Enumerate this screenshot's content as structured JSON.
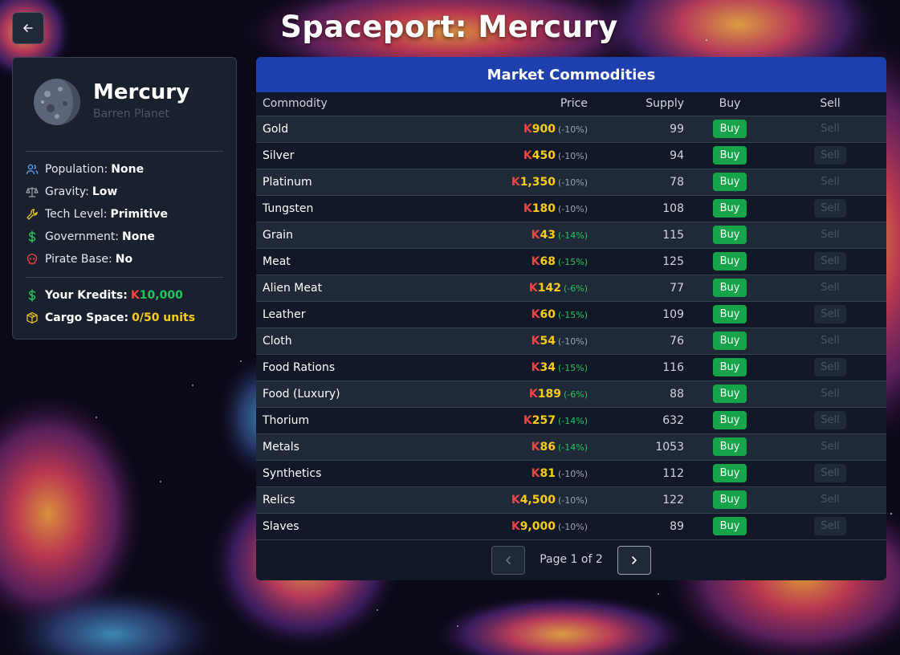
{
  "header": {
    "title": "Spaceport: Mercury",
    "back_icon": "arrow-left-icon"
  },
  "planet": {
    "name": "Mercury",
    "type": "Barren Planet",
    "icon": "planet-icon",
    "stats": [
      {
        "label": "Population:",
        "value": "None",
        "icon": "users-icon",
        "color": "#60a5fa"
      },
      {
        "label": "Gravity:",
        "value": "Low",
        "icon": "scale-icon",
        "color": "#9ca3af"
      },
      {
        "label": "Tech Level:",
        "value": "Primitive",
        "icon": "wrench-icon",
        "color": "#facc15"
      },
      {
        "label": "Government:",
        "value": "None",
        "icon": "dollar-icon",
        "color": "#22c55e"
      },
      {
        "label": "Pirate Base:",
        "value": "No",
        "icon": "skull-icon",
        "color": "#ef4444"
      }
    ],
    "credits": {
      "label": "Your Kredits:",
      "prefix": "K",
      "value": "10,000",
      "icon": "dollar-icon"
    },
    "cargo": {
      "label": "Cargo Space:",
      "value": "0/50 units",
      "icon": "box-icon"
    }
  },
  "market": {
    "title": "Market Commodities",
    "columns": [
      "Commodity",
      "Price",
      "Supply",
      "Buy",
      "Sell"
    ],
    "buy_label": "Buy",
    "sell_label": "Sell",
    "rows": [
      {
        "name": "Gold",
        "price": "900",
        "mod": "(-10%)",
        "mod_color": "gray",
        "supply": "99"
      },
      {
        "name": "Silver",
        "price": "450",
        "mod": "(-10%)",
        "mod_color": "gray",
        "supply": "94"
      },
      {
        "name": "Platinum",
        "price": "1,350",
        "mod": "(-10%)",
        "mod_color": "gray",
        "supply": "78"
      },
      {
        "name": "Tungsten",
        "price": "180",
        "mod": "(-10%)",
        "mod_color": "gray",
        "supply": "108"
      },
      {
        "name": "Grain",
        "price": "43",
        "mod": "(-14%)",
        "mod_color": "green",
        "supply": "115"
      },
      {
        "name": "Meat",
        "price": "68",
        "mod": "(-15%)",
        "mod_color": "green",
        "supply": "125"
      },
      {
        "name": "Alien Meat",
        "price": "142",
        "mod": "(-6%)",
        "mod_color": "green",
        "supply": "77"
      },
      {
        "name": "Leather",
        "price": "60",
        "mod": "(-15%)",
        "mod_color": "green",
        "supply": "109"
      },
      {
        "name": "Cloth",
        "price": "54",
        "mod": "(-10%)",
        "mod_color": "gray",
        "supply": "76"
      },
      {
        "name": "Food Rations",
        "price": "34",
        "mod": "(-15%)",
        "mod_color": "green",
        "supply": "116"
      },
      {
        "name": "Food (Luxury)",
        "price": "189",
        "mod": "(-6%)",
        "mod_color": "green",
        "supply": "88"
      },
      {
        "name": "Thorium",
        "price": "257",
        "mod": "(-14%)",
        "mod_color": "green",
        "supply": "632"
      },
      {
        "name": "Metals",
        "price": "86",
        "mod": "(-14%)",
        "mod_color": "green",
        "supply": "1053"
      },
      {
        "name": "Synthetics",
        "price": "81",
        "mod": "(-10%)",
        "mod_color": "gray",
        "supply": "112"
      },
      {
        "name": "Relics",
        "price": "4,500",
        "mod": "(-10%)",
        "mod_color": "gray",
        "supply": "122"
      },
      {
        "name": "Slaves",
        "price": "9,000",
        "mod": "(-10%)",
        "mod_color": "gray",
        "supply": "89"
      }
    ],
    "pagination": {
      "text": "Page 1 of 2",
      "prev_icon": "chevron-left-icon",
      "next_icon": "chevron-right-icon"
    }
  },
  "colors": {
    "accent": "#1e40af",
    "buy": "#16a34a",
    "kredit_prefix": "#ef4444",
    "price": "#facc15",
    "discount_green": "#22c55e"
  }
}
